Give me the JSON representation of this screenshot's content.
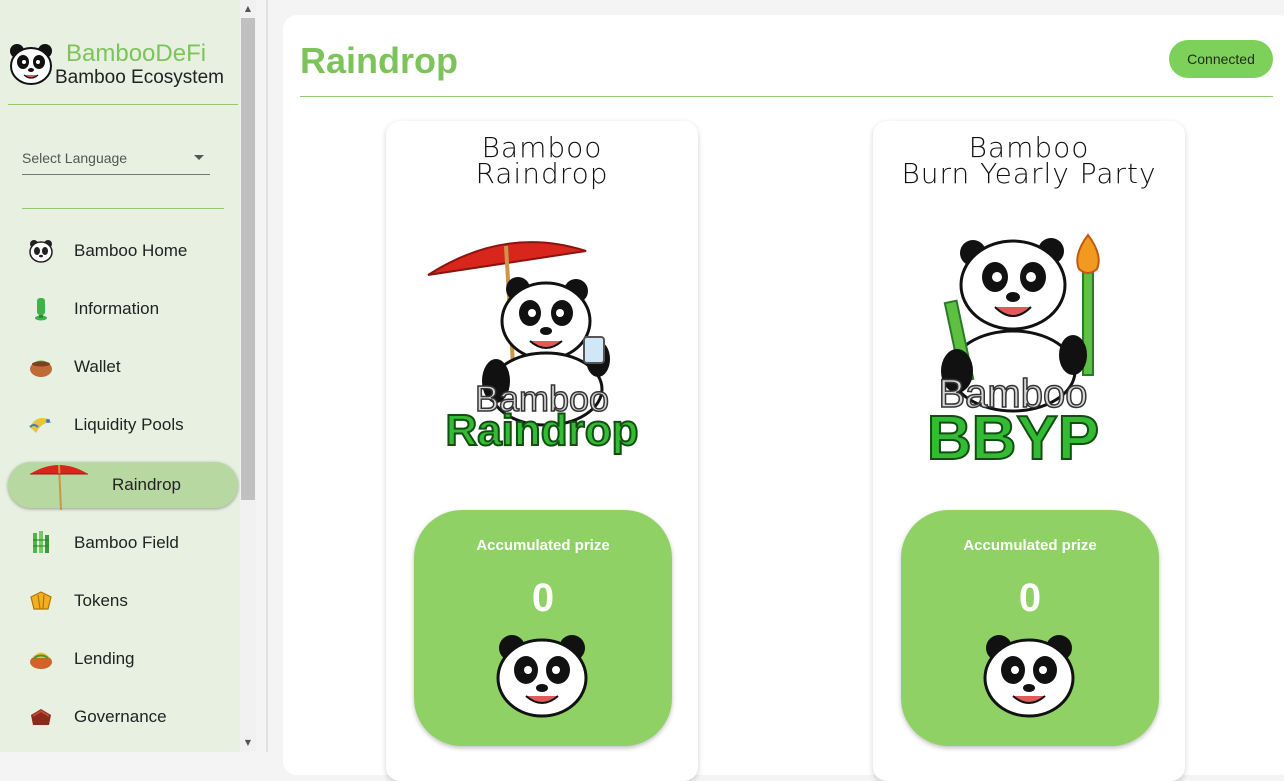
{
  "sidebar": {
    "brand_title": "BambooDeFi",
    "brand_subtitle": "Bamboo Ecosystem",
    "language_select": "Select Language",
    "items": [
      {
        "label": "Bamboo Home",
        "icon": "panda-icon"
      },
      {
        "label": "Information",
        "icon": "info-icon"
      },
      {
        "label": "Wallet",
        "icon": "wallet-icon"
      },
      {
        "label": "Liquidity Pools",
        "icon": "liquidity-icon"
      },
      {
        "label": "Raindrop",
        "icon": "umbrella-icon",
        "active": true
      },
      {
        "label": "Bamboo Field",
        "icon": "bamboo-icon"
      },
      {
        "label": "Tokens",
        "icon": "tokens-icon"
      },
      {
        "label": "Lending",
        "icon": "lending-icon"
      },
      {
        "label": "Governance",
        "icon": "governance-icon"
      }
    ]
  },
  "header": {
    "title": "Raindrop",
    "status": "Connected"
  },
  "cards": [
    {
      "heading_line1": "Bamboo",
      "heading_line2": "Raindrop",
      "art_word1": "Bamboo",
      "art_word2": "Raindrop",
      "prize_label": "Accumulated prize",
      "prize_value": "0"
    },
    {
      "heading_line1": "Bamboo",
      "heading_line2": "Burn Yearly Party",
      "art_word1": "Bamboo",
      "art_word2": "BBYP",
      "prize_label": "Accumulated prize",
      "prize_value": "0"
    }
  ],
  "colors": {
    "accent": "#7cc45a",
    "sidebar_bg": "#e7f0e1",
    "active_item": "#b8d8a2",
    "prize_bg": "#8fd165",
    "status_bg": "#7dd15a"
  }
}
